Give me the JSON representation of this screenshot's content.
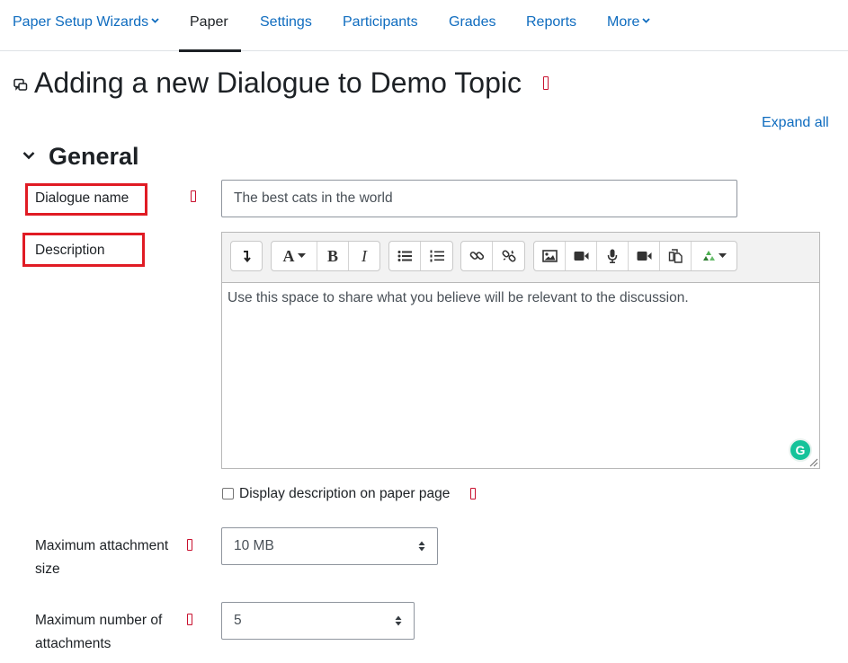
{
  "nav": {
    "items": [
      {
        "label": "Paper Setup Wizards",
        "dropdown": true
      },
      {
        "label": "Paper",
        "active": true
      },
      {
        "label": "Settings"
      },
      {
        "label": "Participants"
      },
      {
        "label": "Grades"
      },
      {
        "label": "Reports"
      },
      {
        "label": "More",
        "dropdown": true
      }
    ]
  },
  "page": {
    "title": "Adding a new Dialogue to Demo Topic",
    "expand_all": "Expand all"
  },
  "section": {
    "title": "General"
  },
  "form": {
    "name_label": "Dialogue name",
    "name_value": "The best cats in the world",
    "description_label": "Description",
    "description_value": "Use this space to share what you believe will be relevant to the discussion.",
    "display_description_label": "Display description on paper page",
    "max_attachment_size_label_line1": "Maximum attachment",
    "max_attachment_size_label_line2": "size",
    "max_attachment_size_value": "10 MB",
    "max_attachments_label_line1": "Maximum number of",
    "max_attachments_label_line2": "attachments",
    "max_attachments_value": "5"
  },
  "editor": {
    "toolbar_icons": [
      "collapse-icon",
      "font-color-icon",
      "bold-icon",
      "italic-icon",
      "unordered-list-icon",
      "ordered-list-icon",
      "link-icon",
      "unlink-icon",
      "image-icon",
      "video-icon",
      "microphone-icon",
      "record-video-icon",
      "manage-files-icon",
      "recycle-icon"
    ],
    "bold_glyph": "B",
    "italic_glyph": "I",
    "font_glyph": "A",
    "grammarly_glyph": "G"
  },
  "colors": {
    "link": "#0f6cbf",
    "highlight_box": "#e01b24",
    "help_icon": "#c8102e"
  }
}
